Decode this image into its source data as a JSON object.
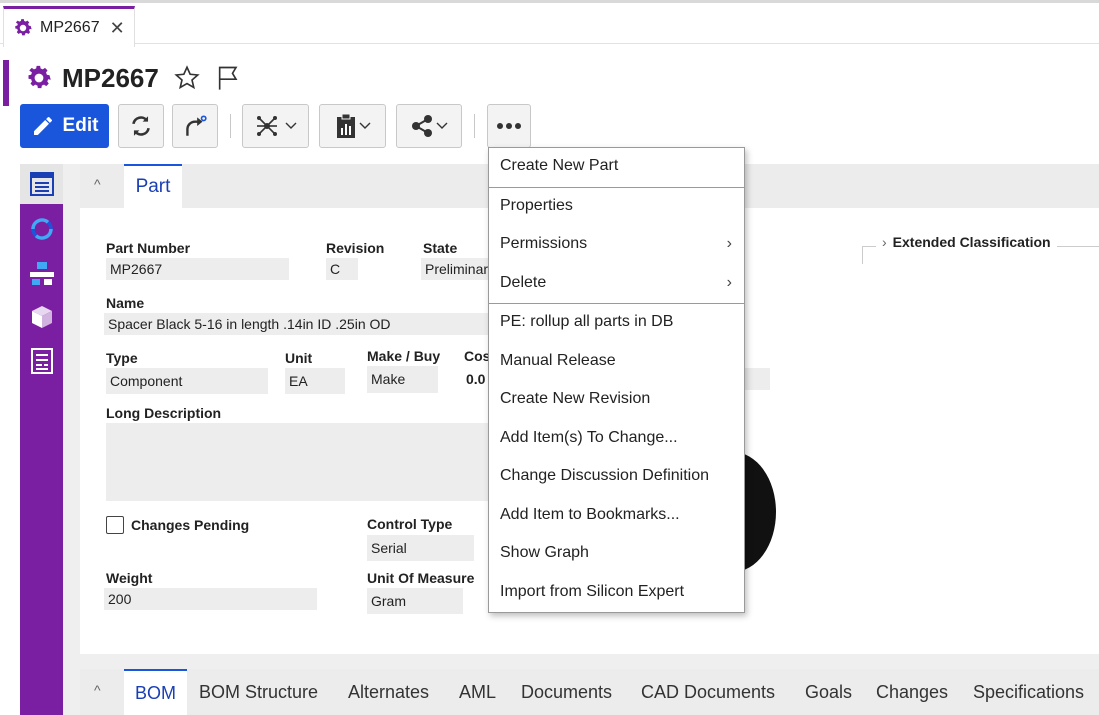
{
  "tab": {
    "title": "MP2667",
    "close": "✕"
  },
  "header": {
    "title": "MP2667"
  },
  "toolbar": {
    "edit_label": "Edit"
  },
  "section": {
    "tab_label": "Part",
    "collapse": "^"
  },
  "form": {
    "part_number_label": "Part Number",
    "part_number": "MP2667",
    "revision_label": "Revision",
    "revision": "C",
    "state_label": "State",
    "state": "Preliminar",
    "name_label": "Name",
    "name": "Spacer Black 5-16 in length .14in ID .25in OD",
    "type_label": "Type",
    "type": "Component",
    "unit_label": "Unit",
    "unit": "EA",
    "make_buy_label": "Make / Buy",
    "make_buy": "Make",
    "cost_label": "Cos",
    "cost": "0.0",
    "long_desc_label": "Long Description",
    "changes_pending_label": "Changes Pending",
    "control_type_label": "Control Type",
    "control_type": "Serial",
    "weight_label": "Weight",
    "weight": "200",
    "uom_label": "Unit Of Measure",
    "uom": "Gram"
  },
  "extended": {
    "label": "Extended Classification",
    "chevron": "›"
  },
  "bottom_tabs": {
    "collapse": "^",
    "items": [
      "BOM",
      "BOM Structure",
      "Alternates",
      "AML",
      "Documents",
      "CAD Documents",
      "Goals",
      "Changes",
      "Specifications"
    ]
  },
  "menu": {
    "arrow": "›",
    "items": [
      "Create New Part",
      "Properties",
      "Permissions",
      "Delete",
      "PE: rollup all parts in DB",
      "Manual Release",
      "Create New Revision",
      "Add Item(s) To Change...",
      "Change Discussion Definition",
      "Add Item to Bookmarks...",
      "Show Graph",
      "Import from Silicon Expert"
    ]
  },
  "colors": {
    "accent": "#7b1fa2",
    "primary": "#1a56db"
  }
}
